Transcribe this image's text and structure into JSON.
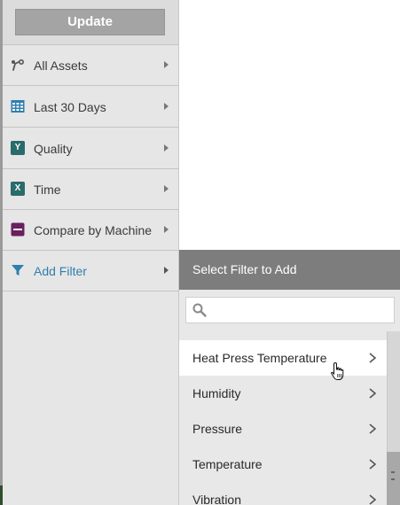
{
  "update_button": {
    "label": "Update"
  },
  "menu": [
    {
      "label": "All Assets",
      "icon": "assets-icon",
      "color": "#555555"
    },
    {
      "label": "Last 30 Days",
      "icon": "calendar-icon",
      "color": "#2f7fae"
    },
    {
      "label": "Quality",
      "icon": "y-axis-badge-icon",
      "badge": "Y",
      "color": "#2a6b6b"
    },
    {
      "label": "Time",
      "icon": "x-axis-badge-icon",
      "badge": "X",
      "color": "#2a6b6b"
    },
    {
      "label": "Compare by Machine",
      "icon": "compare-icon",
      "color": "#6a1f5e"
    },
    {
      "label": "Add Filter",
      "icon": "filter-icon",
      "color": "#2f7fae"
    }
  ],
  "filter_panel": {
    "title": "Select Filter to Add",
    "search_placeholder": "",
    "items": [
      {
        "label": "Heat Press Temperature"
      },
      {
        "label": "Humidity"
      },
      {
        "label": "Pressure"
      },
      {
        "label": "Temperature"
      },
      {
        "label": "Vibration"
      }
    ]
  }
}
